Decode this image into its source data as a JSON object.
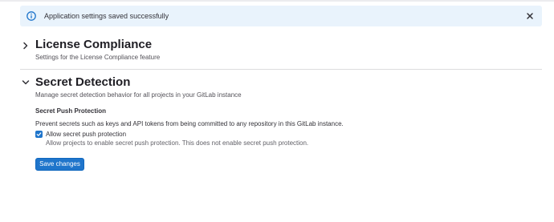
{
  "alert": {
    "message": "Application settings saved successfully",
    "icon": "info-icon",
    "close_icon": "close-icon"
  },
  "sections": [
    {
      "title": "License Compliance",
      "description": "Settings for the License Compliance feature",
      "expanded": false
    },
    {
      "title": "Secret Detection",
      "description": "Manage secret detection behavior for all projects in your GitLab instance",
      "expanded": true
    }
  ],
  "secret_detection": {
    "heading": "Secret Push Protection",
    "help": "Prevent secrets such as keys and API tokens from being committed to any repository in this GitLab instance.",
    "checkbox_label": "Allow secret push protection",
    "checkbox_checked": true,
    "checkbox_help": "Allow projects to enable secret push protection. This does not enable secret push protection.",
    "save_label": "Save changes"
  },
  "colors": {
    "alert_bg": "#e9f3fc",
    "info": "#1f75cb",
    "primary": "#1f75cb"
  }
}
